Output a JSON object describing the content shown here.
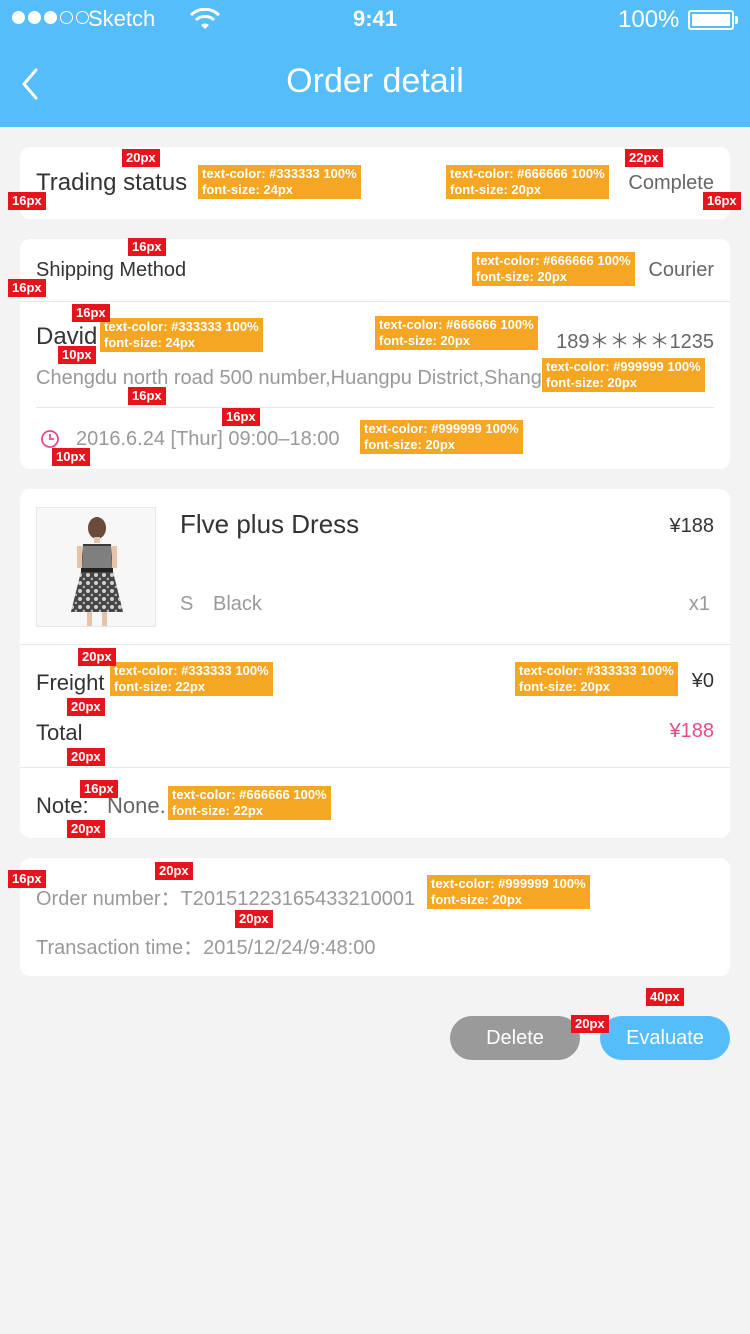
{
  "status_bar": {
    "carrier": "Sketch",
    "time": "9:41",
    "battery": "100%"
  },
  "header": {
    "title": "Order detail"
  },
  "trading": {
    "label": "Trading status",
    "value": "Complete"
  },
  "shipping": {
    "label": "Shipping Method",
    "value": "Courier",
    "name": "David",
    "phone": "189＊＊＊＊1235",
    "address": "Chengdu north road 500 number,Huangpu District,Shanghai",
    "time": "2016.6.24 [Thur] 09:00–18:00"
  },
  "product": {
    "name": "Flve plus Dress",
    "price": "¥188",
    "size": "S",
    "color": "Black",
    "qty": "x1",
    "image_icon": "dress-photo"
  },
  "summary": {
    "freight_label": "Freight",
    "freight_value": "¥0",
    "total_label": "Total",
    "total_value": "¥188",
    "note_label": "Note:",
    "note_value": "None."
  },
  "order": {
    "number_label": "Order number：",
    "number_value": "T20151223165433210001",
    "time_label": "Transaction time：",
    "time_value": "2015/12/24/9:48:00"
  },
  "actions": {
    "delete": "Delete",
    "evaluate": "Evaluate"
  },
  "colors": {
    "accent": "#55bdf9",
    "price": "#e84b8a",
    "text_primary": "#333333",
    "text_secondary": "#666666",
    "text_muted": "#999999"
  },
  "annotations": {
    "t1": "text-color: #333333 100%",
    "f1": "font-size: 24px",
    "t2": "text-color: #666666 100%",
    "f2": "font-size: 20px",
    "t3": "text-color: #666666 100%",
    "f3": "font-size: 20px",
    "t4": "text-color: #333333 100%",
    "f4": "font-size: 24px",
    "t5": "text-color: #666666 100%",
    "f5": "font-size: 20px",
    "t6": "text-color: #999999 100%",
    "f6": "font-size: 20px",
    "t7": "text-color: #999999 100%",
    "f7": "font-size: 20px",
    "t8": "text-color: #333333 100%",
    "f8": "font-size: 22px",
    "t9": "text-color: #333333 100%",
    "f9": "font-size: 20px",
    "t10": "text-color: #666666 100%",
    "f10": "font-size: 22px",
    "t11": "text-color: #999999 100%",
    "f11": "font-size: 20px",
    "m20": "20px",
    "m16": "16px",
    "m22": "22px",
    "m10": "10px",
    "m40": "40px"
  }
}
